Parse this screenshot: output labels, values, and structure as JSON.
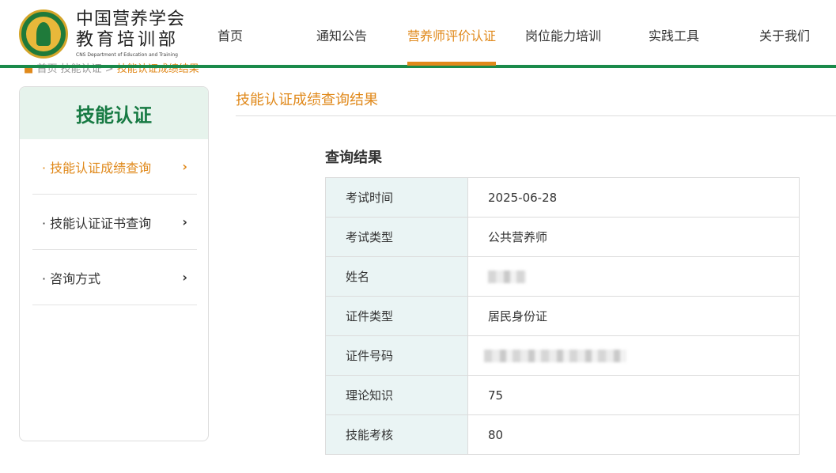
{
  "header": {
    "brand_line1": "中国营养学会",
    "brand_line2": "教育培训部",
    "brand_en": "CNS Department of Education and Training",
    "nav": [
      {
        "label": "首页"
      },
      {
        "label": "通知公告"
      },
      {
        "label": "营养师评价认证",
        "active": true
      },
      {
        "label": "岗位能力培训"
      },
      {
        "label": "实践工具"
      },
      {
        "label": "关于我们"
      }
    ],
    "accent_color": "#e0891b",
    "brand_green": "#1a8a4a"
  },
  "breadcrumb": {
    "home": "首页",
    "level1": "技能认证 >",
    "current": "技能认证成绩结果"
  },
  "sidebar": {
    "title": "技能认证",
    "items": [
      {
        "label": "· 技能认证成绩查询",
        "active": true,
        "icon": "chevron-right-icon"
      },
      {
        "label": "· 技能认证证书查询",
        "icon": "chevron-right-icon"
      },
      {
        "label": "· 咨询方式",
        "icon": "chevron-right-icon"
      }
    ]
  },
  "main": {
    "page_title": "技能认证成绩查询结果",
    "result_title": "查询结果",
    "rows": [
      {
        "key": "考试时间",
        "value": "2025-06-28"
      },
      {
        "key": "考试类型",
        "value": "公共营养师"
      },
      {
        "key": "姓名",
        "value": ""
      },
      {
        "key": "证件类型",
        "value": "居民身份证"
      },
      {
        "key": "证件号码",
        "value": ""
      },
      {
        "key": "理论知识",
        "value": "75"
      },
      {
        "key": "技能考核",
        "value": "80"
      }
    ]
  }
}
